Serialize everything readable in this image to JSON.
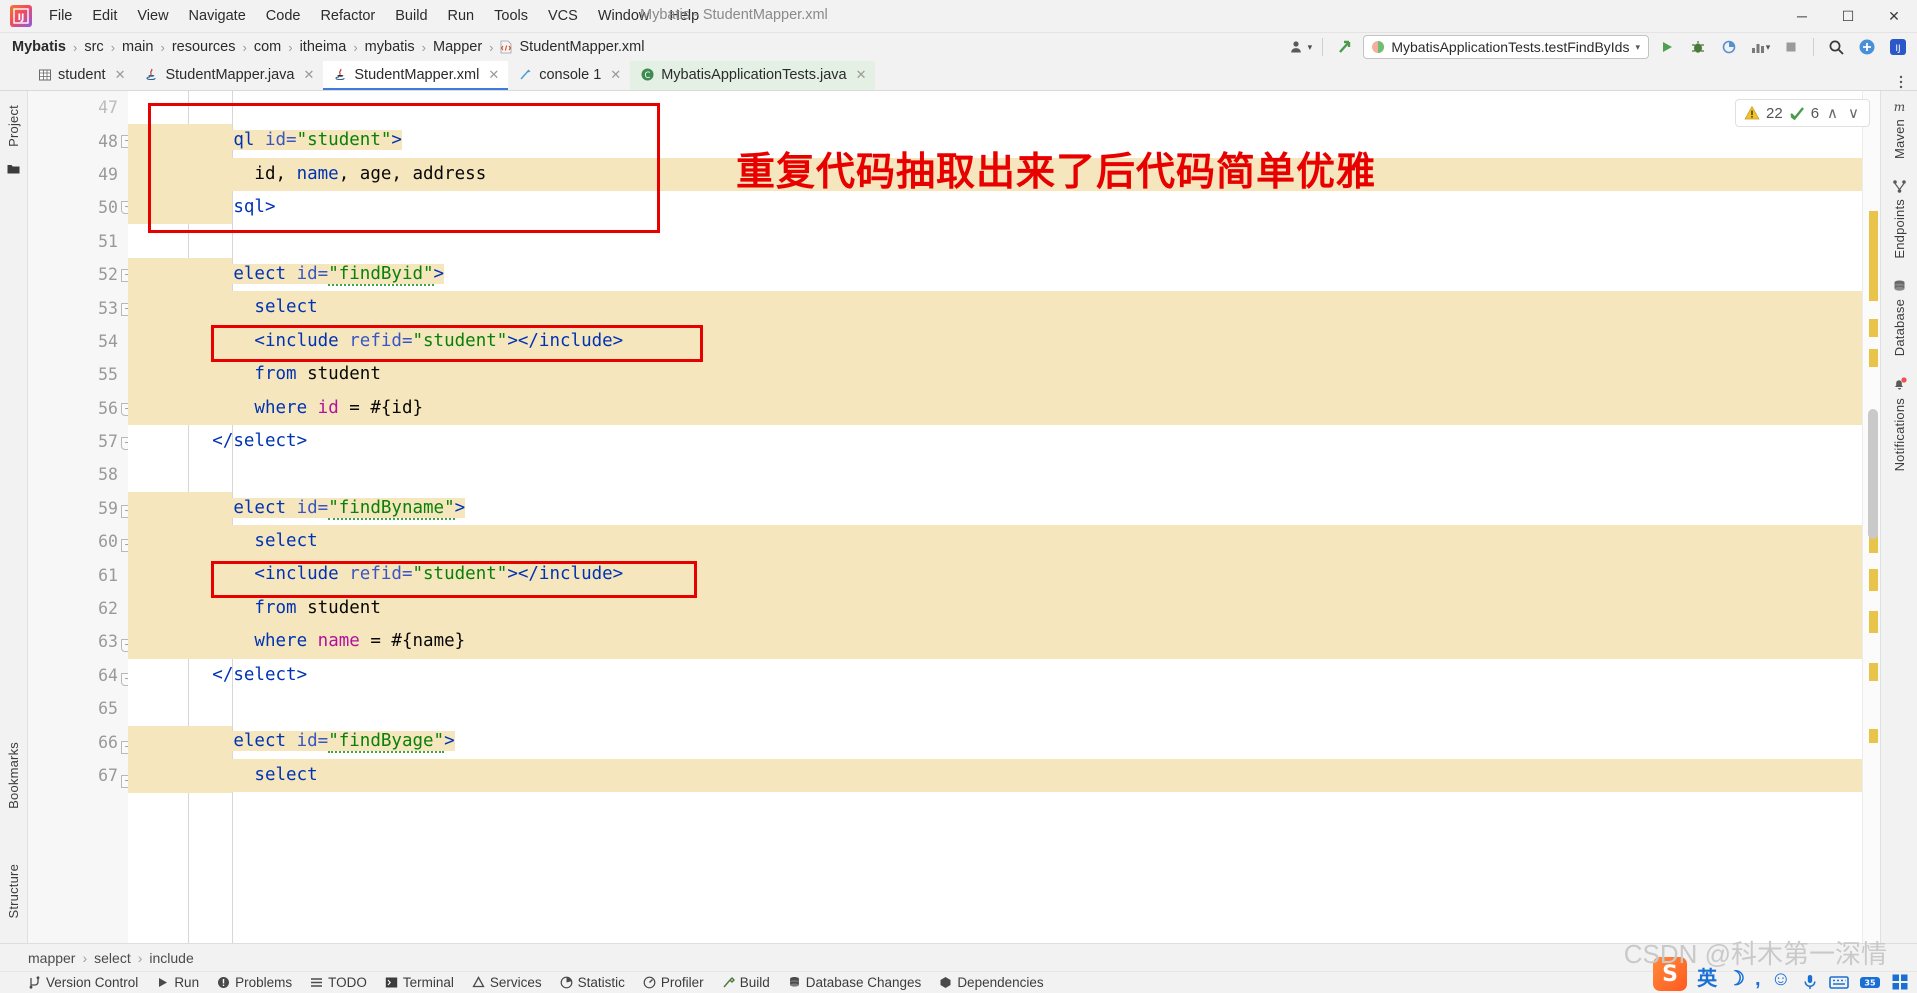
{
  "window": {
    "title": "Mybatis - StudentMapper.xml",
    "logo_text": "IJ",
    "minimize": "─",
    "maximize": "☐",
    "close": "✕"
  },
  "menubar": {
    "items": [
      {
        "label": "File"
      },
      {
        "label": "Edit"
      },
      {
        "label": "View"
      },
      {
        "label": "Navigate"
      },
      {
        "label": "Code"
      },
      {
        "label": "Refactor"
      },
      {
        "label": "Build"
      },
      {
        "label": "Run"
      },
      {
        "label": "Tools"
      },
      {
        "label": "VCS"
      },
      {
        "label": "Window"
      },
      {
        "label": "Help"
      }
    ]
  },
  "breadcrumb": {
    "separator": "›",
    "items": [
      {
        "label": "Mybatis"
      },
      {
        "label": "src"
      },
      {
        "label": "main"
      },
      {
        "label": "resources"
      },
      {
        "label": "com"
      },
      {
        "label": "itheima"
      },
      {
        "label": "mybatis"
      },
      {
        "label": "Mapper"
      },
      {
        "label": "StudentMapper.xml"
      }
    ]
  },
  "toolbar": {
    "profile_icon": "user-icon",
    "chevron": "▾",
    "updates_icon": "arrow-up-green-icon",
    "run_config": "MybatisApplicationTests.testFindByIds",
    "run_icon": "run-icon",
    "debug_icon": "debug-icon",
    "coverage_icon": "coverage-icon",
    "profile_run_icon": "profiler-icon",
    "stop_icon": "stop-icon",
    "search_icon": "search-icon",
    "plugin_icon": "plugin-update-icon",
    "ide_icon": "ide-icon"
  },
  "tabs": [
    {
      "label": "student",
      "icon": "database-table-icon",
      "closable": true,
      "state": "normal"
    },
    {
      "label": "StudentMapper.java",
      "icon": "java-file-icon",
      "closable": true,
      "state": "normal"
    },
    {
      "label": "StudentMapper.xml",
      "icon": "xml-file-icon",
      "closable": true,
      "state": "active"
    },
    {
      "label": "console 1",
      "icon": "console-icon",
      "closable": true,
      "state": "normal"
    },
    {
      "label": "MybatisApplicationTests.java",
      "icon": "java-class-icon",
      "closable": true,
      "state": "tinted"
    }
  ],
  "tabbar_overflow_icon": "more-options-icon",
  "left_strip": {
    "items": [
      {
        "label": "Project",
        "icon": "project-icon"
      },
      {
        "label": "Bookmarks",
        "icon": "bookmark-icon"
      },
      {
        "label": "Structure",
        "icon": "structure-icon"
      }
    ]
  },
  "right_strip": {
    "items": [
      {
        "label": "Maven",
        "icon": "maven-icon"
      },
      {
        "label": "Endpoints",
        "icon": "endpoints-icon"
      },
      {
        "label": "Database",
        "icon": "database-icon"
      },
      {
        "label": "Notifications",
        "icon": "notifications-icon",
        "badge": true
      }
    ]
  },
  "inspection_widget": {
    "warning_icon": "warning-triangle-icon",
    "warning_count": "22",
    "check_icon": "inspection-ok-icon",
    "check_count": "6",
    "prev_icon": "∧",
    "next_icon": "∨"
  },
  "annotation": {
    "note_text": "重复代码抽取出来了后代码简单优雅",
    "note_color": "#e80000",
    "box_color": "#e60000"
  },
  "editor": {
    "first_line_number": 47,
    "lines": [
      {
        "num": 47,
        "fold": null,
        "highlight": false,
        "tokens": []
      },
      {
        "num": 48,
        "fold": "collapse",
        "highlight": false,
        "tokens": [
          {
            "t": "tag",
            "v": "        <sql "
          },
          {
            "t": "attr",
            "v": "id="
          },
          {
            "t": "val",
            "v": "\"student\""
          },
          {
            "t": "tag",
            "v": ">"
          }
        ]
      },
      {
        "num": 49,
        "fold": null,
        "highlight": true,
        "tokens": [
          {
            "t": "plain",
            "v": "            id, "
          },
          {
            "t": "kw",
            "v": "name"
          },
          {
            "t": "plain",
            "v": ", age, address"
          }
        ]
      },
      {
        "num": 50,
        "fold": "collapse-end",
        "highlight": false,
        "tokens": [
          {
            "t": "tag",
            "v": "        </sql>"
          }
        ]
      },
      {
        "num": 51,
        "fold": null,
        "highlight": false,
        "tokens": []
      },
      {
        "num": 52,
        "fold": "collapse",
        "highlight": false,
        "tokens": [
          {
            "t": "tag",
            "v": "        <select "
          },
          {
            "t": "attr",
            "v": "id="
          },
          {
            "t": "val squig",
            "v": "\"findByid\""
          },
          {
            "t": "tag",
            "v": ">"
          }
        ]
      },
      {
        "num": 53,
        "fold": "collapse",
        "highlight": true,
        "tokens": [
          {
            "t": "kw",
            "v": "            select"
          }
        ]
      },
      {
        "num": 54,
        "fold": null,
        "highlight": true,
        "tokens": [
          {
            "t": "tag",
            "v": "            <include "
          },
          {
            "t": "attr",
            "v": "refid="
          },
          {
            "t": "val",
            "v": "\"student\""
          },
          {
            "t": "tag",
            "v": "></include>"
          }
        ]
      },
      {
        "num": 55,
        "fold": null,
        "highlight": true,
        "tokens": [
          {
            "t": "kw",
            "v": "            from"
          },
          {
            "t": "plain",
            "v": " student"
          }
        ]
      },
      {
        "num": 56,
        "fold": "collapse-end",
        "highlight": true,
        "tokens": [
          {
            "t": "kw",
            "v": "            where"
          },
          {
            "t": "plain",
            "v": " "
          },
          {
            "t": "param",
            "v": "id"
          },
          {
            "t": "plain",
            "v": " = #{id}"
          }
        ]
      },
      {
        "num": 57,
        "fold": "collapse-end",
        "highlight": false,
        "tokens": [
          {
            "t": "tag",
            "v": "        </select>"
          }
        ]
      },
      {
        "num": 58,
        "fold": null,
        "highlight": false,
        "tokens": []
      },
      {
        "num": 59,
        "fold": "collapse",
        "highlight": false,
        "tokens": [
          {
            "t": "tag",
            "v": "        <select "
          },
          {
            "t": "attr",
            "v": "id="
          },
          {
            "t": "val squig",
            "v": "\"findByname\""
          },
          {
            "t": "tag",
            "v": ">"
          }
        ]
      },
      {
        "num": 60,
        "fold": "collapse",
        "highlight": true,
        "tokens": [
          {
            "t": "kw",
            "v": "            select"
          }
        ]
      },
      {
        "num": 61,
        "fold": null,
        "highlight": true,
        "tokens": [
          {
            "t": "tag",
            "v": "            <include "
          },
          {
            "t": "attr",
            "v": "refid="
          },
          {
            "t": "val",
            "v": "\"student\""
          },
          {
            "t": "tag",
            "v": "></include>"
          }
        ]
      },
      {
        "num": 62,
        "fold": null,
        "highlight": true,
        "tokens": [
          {
            "t": "kw",
            "v": "            from"
          },
          {
            "t": "plain",
            "v": " student"
          }
        ]
      },
      {
        "num": 63,
        "fold": "collapse-end",
        "highlight": true,
        "tokens": [
          {
            "t": "kw",
            "v": "            where"
          },
          {
            "t": "plain",
            "v": " "
          },
          {
            "t": "param",
            "v": "name"
          },
          {
            "t": "plain",
            "v": " = #{name}"
          }
        ]
      },
      {
        "num": 64,
        "fold": "collapse-end",
        "highlight": false,
        "tokens": [
          {
            "t": "tag",
            "v": "        </select>"
          }
        ]
      },
      {
        "num": 65,
        "fold": null,
        "highlight": false,
        "tokens": []
      },
      {
        "num": 66,
        "fold": "collapse",
        "highlight": false,
        "tokens": [
          {
            "t": "tag",
            "v": "        <select "
          },
          {
            "t": "attr",
            "v": "id="
          },
          {
            "t": "val squig",
            "v": "\"findByage\""
          },
          {
            "t": "tag",
            "v": ">"
          }
        ]
      },
      {
        "num": 67,
        "fold": "collapse",
        "highlight": true,
        "tokens": [
          {
            "t": "kw",
            "v": "            select"
          }
        ]
      }
    ]
  },
  "bottom_breadcrumb": {
    "separator": "›",
    "items": [
      {
        "label": "mapper"
      },
      {
        "label": "select"
      },
      {
        "label": "include"
      }
    ]
  },
  "statusbar": {
    "items": [
      {
        "label": "Version Control",
        "icon": "vcs-icon"
      },
      {
        "label": "Run",
        "icon": "run-icon"
      },
      {
        "label": "Problems",
        "icon": "problems-icon"
      },
      {
        "label": "TODO",
        "icon": "todo-icon"
      },
      {
        "label": "Terminal",
        "icon": "terminal-icon"
      },
      {
        "label": "Services",
        "icon": "services-icon"
      },
      {
        "label": "Statistic",
        "icon": "statistic-icon"
      },
      {
        "label": "Profiler",
        "icon": "profiler-icon"
      },
      {
        "label": "Build",
        "icon": "build-icon"
      },
      {
        "label": "Database Changes",
        "icon": "db-changes-icon"
      },
      {
        "label": "Dependencies",
        "icon": "dependencies-icon"
      }
    ]
  },
  "tray": {
    "ime_logo": "S",
    "ime_lang": "英",
    "moon_icon": "☽",
    "comma_icon": ",",
    "smiley_icon": "☺",
    "mic_icon": "mic-icon",
    "keyboard_icon": "keyboard-icon",
    "box_icon": "35",
    "apps_icon": "apps-icon",
    "watermark": "CSDN @科木第一深情"
  }
}
